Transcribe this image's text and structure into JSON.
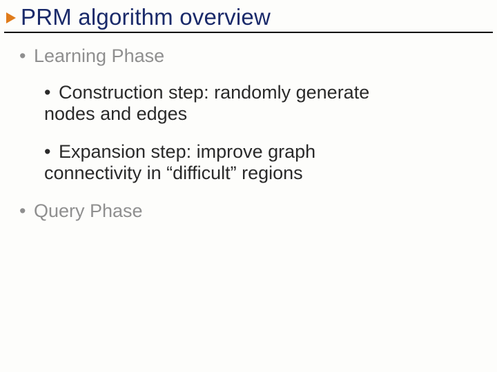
{
  "title": "PRM algorithm overview",
  "bullets": {
    "learning": "Learning Phase",
    "construction": "Construction step: randomly generate nodes and edges",
    "expansion": "Expansion step: improve graph connectivity in “difficult” regions",
    "query": "Query Phase"
  },
  "glyphs": {
    "dot": "•"
  }
}
